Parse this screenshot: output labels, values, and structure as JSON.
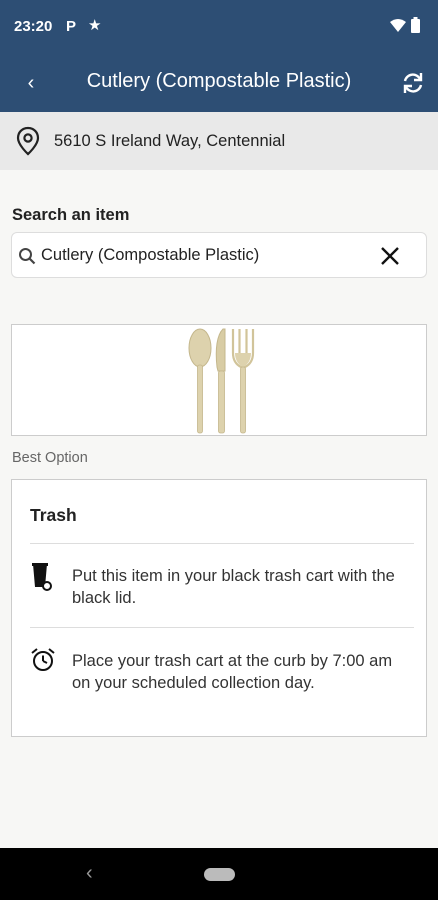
{
  "status_bar": {
    "time": "23:20",
    "notification_icons": [
      "parking-icon",
      "star-icon"
    ],
    "system_icons": [
      "wifi-icon",
      "battery-icon"
    ]
  },
  "app_bar": {
    "title": "Cutlery (Compostable Plastic)",
    "background_color": "#2d4e74"
  },
  "address": {
    "text": "5610 S Ireland Way, Centennial"
  },
  "search": {
    "label": "Search an item",
    "value": "Cutlery (Compostable Plastic)"
  },
  "result": {
    "section_label": "Best Option",
    "card": {
      "title": "Trash",
      "instructions": [
        {
          "icon": "trash-cart-icon",
          "text": "Put this item in your black trash cart with the black lid."
        },
        {
          "icon": "alarm-clock-icon",
          "text": "Place your trash cart at the curb by 7:00 am on your scheduled collection day."
        }
      ]
    }
  }
}
